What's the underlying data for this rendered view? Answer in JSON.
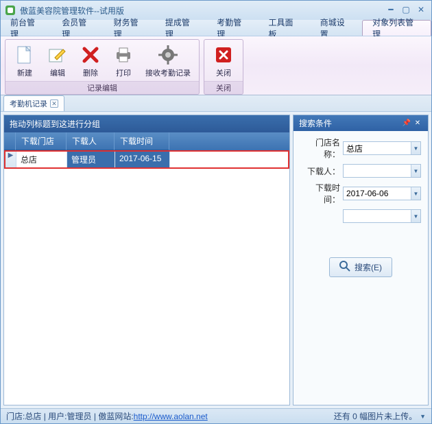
{
  "window": {
    "title": "傲蓝美容院管理软件--试用版"
  },
  "menu": {
    "items": [
      {
        "label": "前台管理"
      },
      {
        "label": "会员管理"
      },
      {
        "label": "财务管理"
      },
      {
        "label": "提成管理"
      },
      {
        "label": "考勤管理"
      },
      {
        "label": "工具面板"
      },
      {
        "label": "商城设置"
      },
      {
        "label": "对象列表管理"
      }
    ],
    "active_index": 7
  },
  "ribbon": {
    "groups": [
      {
        "label": "记录编辑",
        "buttons": [
          {
            "label": "新建",
            "icon": "new"
          },
          {
            "label": "编辑",
            "icon": "edit"
          },
          {
            "label": "删除",
            "icon": "delete"
          },
          {
            "label": "打印",
            "icon": "print"
          },
          {
            "label": "接收考勤记录",
            "icon": "gear"
          }
        ]
      },
      {
        "label": "关闭",
        "buttons": [
          {
            "label": "关闭",
            "icon": "close"
          }
        ]
      }
    ]
  },
  "tabs": {
    "active": {
      "label": "考勤机记录"
    }
  },
  "grid": {
    "group_hint": "拖动列标题到这进行分组",
    "columns": [
      "下载门店",
      "下载人",
      "下载时间"
    ],
    "rows": [
      {
        "store": "总店",
        "user": "管理员",
        "time": "2017-06-15"
      }
    ]
  },
  "search": {
    "title": "搜索条件",
    "fields": {
      "store": {
        "label": "门店名称：",
        "value": "总店"
      },
      "user": {
        "label": "下载人：",
        "value": ""
      },
      "time": {
        "label": "下载时间：",
        "value": "2017-06-06"
      },
      "extra": {
        "value": ""
      }
    },
    "button": "搜索(E)"
  },
  "statusbar": {
    "store_label": "门店: ",
    "store": "总店",
    "user_label": "用户: ",
    "user": "管理员",
    "site_label": "傲蓝网站: ",
    "url": "http://www.aolan.net",
    "right": "还有 0 幅图片未上传。"
  }
}
